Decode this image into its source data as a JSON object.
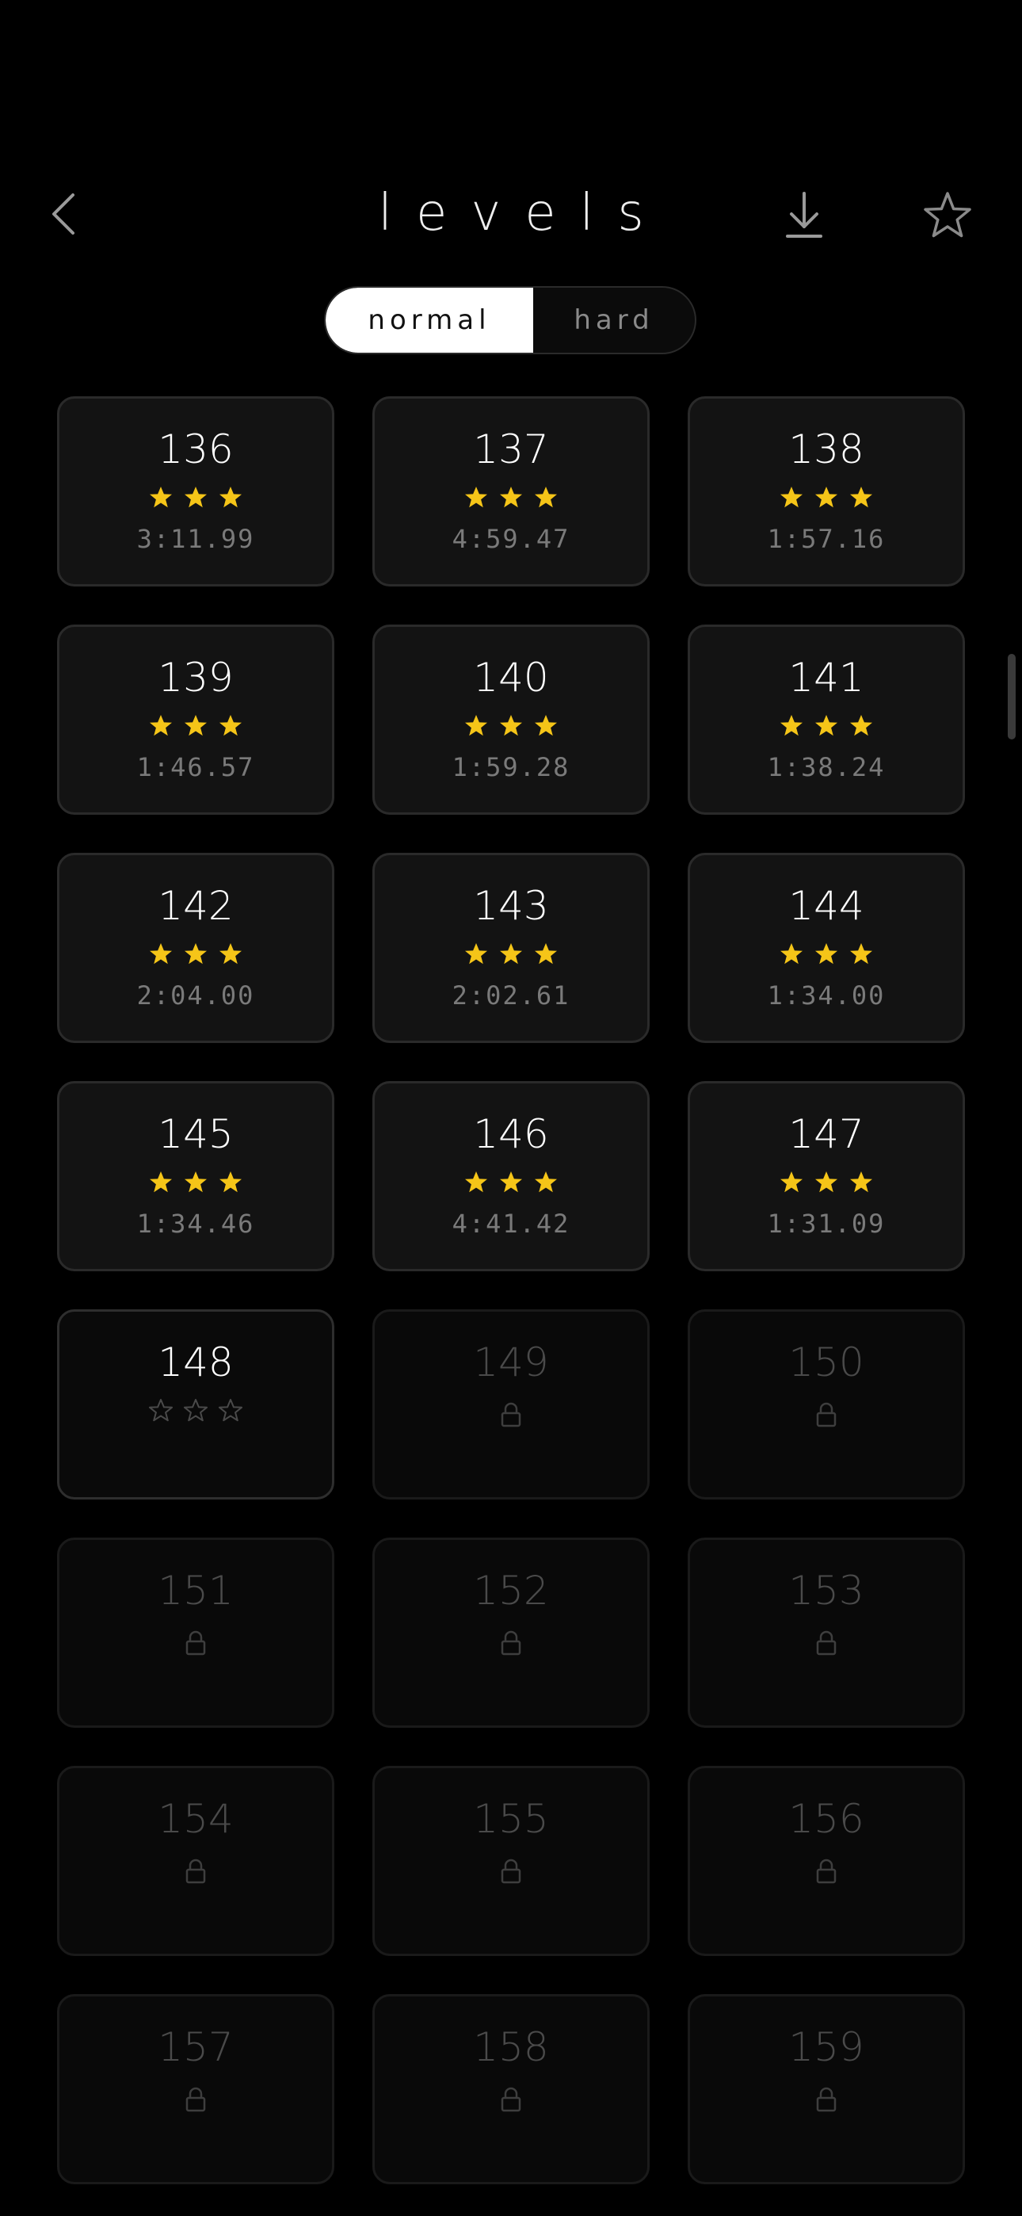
{
  "header": {
    "title": "levels",
    "back_icon": "chevron-left-icon",
    "download_icon": "download-icon",
    "favorites_icon": "star-outline-icon"
  },
  "difficulty": {
    "options": [
      "normal",
      "hard"
    ],
    "selected": "normal"
  },
  "colors": {
    "star_filled": "#f5c518",
    "background": "#000000",
    "card": "#131313"
  },
  "levels": [
    {
      "number": "136",
      "status": "completed",
      "stars": 3,
      "time": "3:11.99"
    },
    {
      "number": "137",
      "status": "completed",
      "stars": 3,
      "time": "4:59.47"
    },
    {
      "number": "138",
      "status": "completed",
      "stars": 3,
      "time": "1:57.16"
    },
    {
      "number": "139",
      "status": "completed",
      "stars": 3,
      "time": "1:46.57"
    },
    {
      "number": "140",
      "status": "completed",
      "stars": 3,
      "time": "1:59.28"
    },
    {
      "number": "141",
      "status": "completed",
      "stars": 3,
      "time": "1:38.24"
    },
    {
      "number": "142",
      "status": "completed",
      "stars": 3,
      "time": "2:04.00"
    },
    {
      "number": "143",
      "status": "completed",
      "stars": 3,
      "time": "2:02.61"
    },
    {
      "number": "144",
      "status": "completed",
      "stars": 3,
      "time": "1:34.00"
    },
    {
      "number": "145",
      "status": "completed",
      "stars": 3,
      "time": "1:34.46"
    },
    {
      "number": "146",
      "status": "completed",
      "stars": 3,
      "time": "4:41.42"
    },
    {
      "number": "147",
      "status": "completed",
      "stars": 3,
      "time": "1:31.09"
    },
    {
      "number": "148",
      "status": "unlocked",
      "stars": 0,
      "time": ""
    },
    {
      "number": "149",
      "status": "locked",
      "stars": 0,
      "time": ""
    },
    {
      "number": "150",
      "status": "locked",
      "stars": 0,
      "time": ""
    },
    {
      "number": "151",
      "status": "locked",
      "stars": 0,
      "time": ""
    },
    {
      "number": "152",
      "status": "locked",
      "stars": 0,
      "time": ""
    },
    {
      "number": "153",
      "status": "locked",
      "stars": 0,
      "time": ""
    },
    {
      "number": "154",
      "status": "locked",
      "stars": 0,
      "time": ""
    },
    {
      "number": "155",
      "status": "locked",
      "stars": 0,
      "time": ""
    },
    {
      "number": "156",
      "status": "locked",
      "stars": 0,
      "time": ""
    },
    {
      "number": "157",
      "status": "locked",
      "stars": 0,
      "time": ""
    },
    {
      "number": "158",
      "status": "locked",
      "stars": 0,
      "time": ""
    },
    {
      "number": "159",
      "status": "locked",
      "stars": 0,
      "time": ""
    }
  ]
}
